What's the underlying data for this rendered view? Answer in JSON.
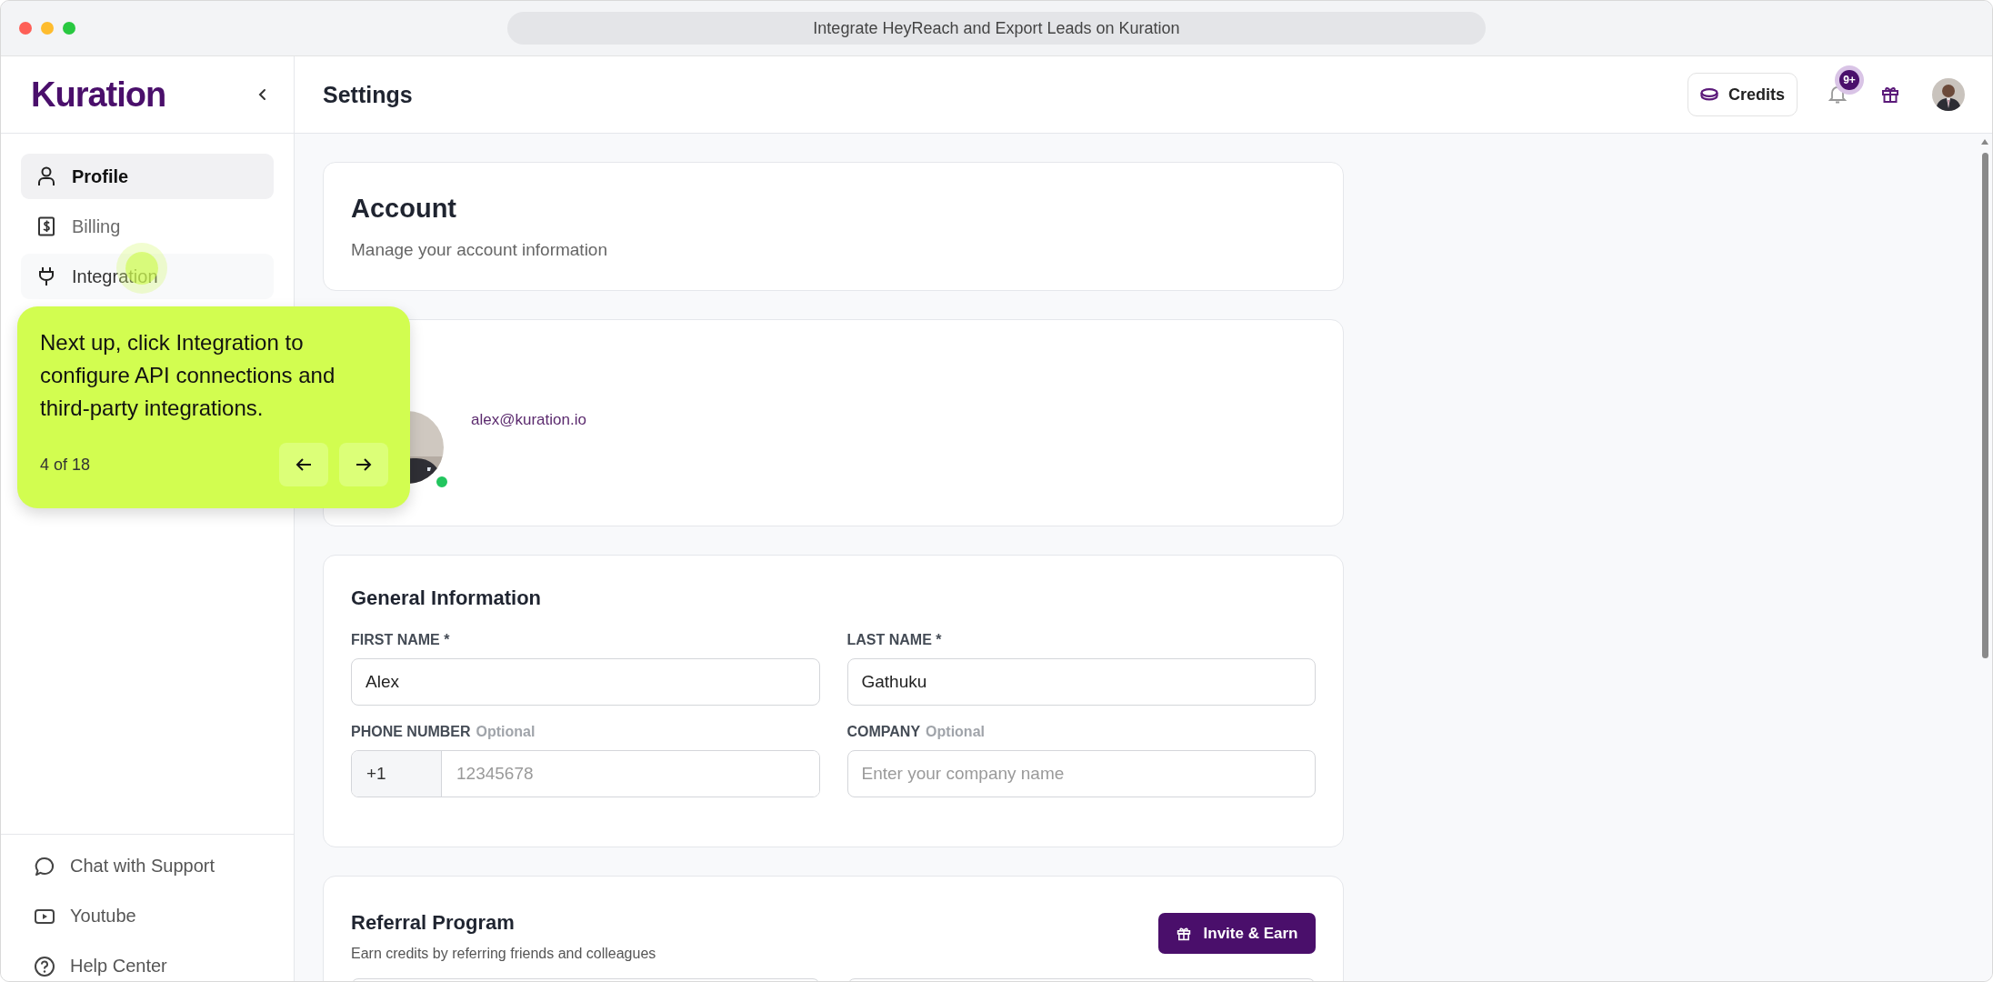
{
  "window": {
    "title": "Integrate HeyReach and Export Leads on Kuration"
  },
  "sidebar": {
    "logo": "Kuration",
    "items": [
      {
        "label": "Profile",
        "selected": true,
        "hovered": false
      },
      {
        "label": "Billing",
        "selected": false,
        "hovered": false
      },
      {
        "label": "Integration",
        "selected": false,
        "hovered": true
      }
    ],
    "footer_items": [
      {
        "label": "Chat with Support"
      },
      {
        "label": "Youtube"
      },
      {
        "label": "Help Center"
      }
    ]
  },
  "header": {
    "title": "Settings",
    "credits_button": "Credits",
    "notification_badge": "9+"
  },
  "account": {
    "title": "Account",
    "subtitle": "Manage your account information"
  },
  "profile": {
    "email": "alex@kuration.io",
    "online": true
  },
  "general": {
    "title": "General Information",
    "fields": [
      {
        "label": "FIRST NAME *",
        "value": "Alex"
      },
      {
        "label": "LAST NAME *",
        "value": "Gathuku"
      },
      {
        "label": "PHONE NUMBER",
        "optional": "Optional",
        "prefix": "+1",
        "placeholder": "12345678"
      },
      {
        "label": "COMPANY",
        "optional": "Optional",
        "placeholder": "Enter your company name"
      }
    ]
  },
  "referral": {
    "title": "Referral Program",
    "subtitle": "Earn credits by referring friends and colleagues",
    "button": "Invite & Earn"
  },
  "tour": {
    "text": "Next up, click Integration to configure API connections and third-party integrations.",
    "step": "4 of 18"
  }
}
